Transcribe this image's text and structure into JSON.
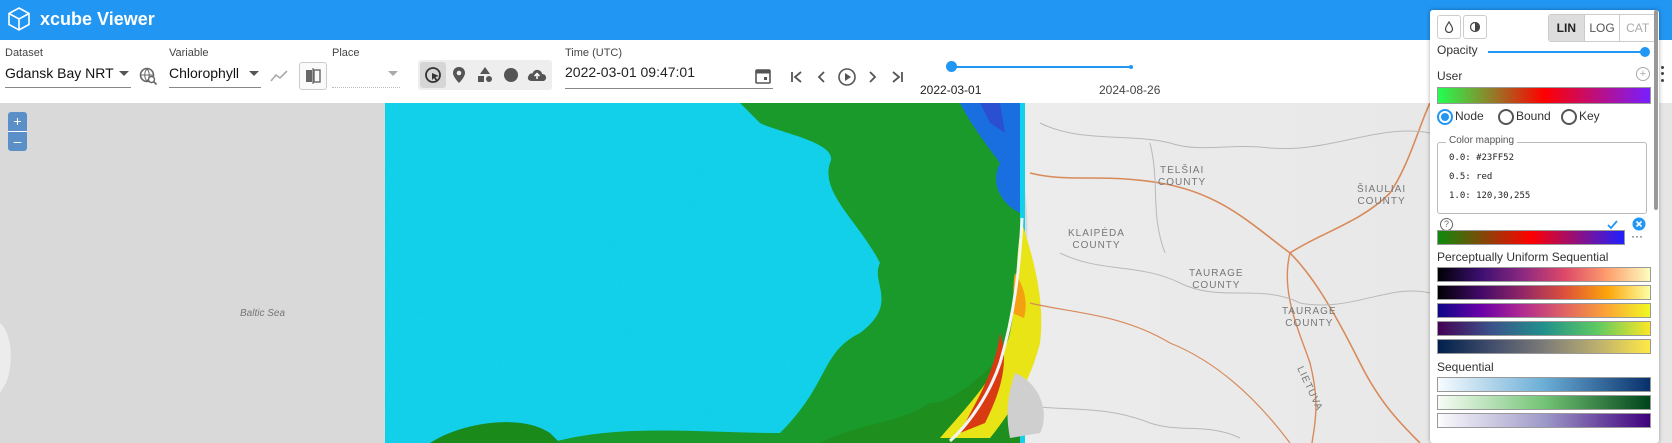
{
  "app": {
    "title": "xcube Viewer"
  },
  "toolbar": {
    "dataset": {
      "label": "Dataset",
      "value": "Gdansk Bay NRT"
    },
    "variable": {
      "label": "Variable",
      "value": "Chlorophyll"
    },
    "place": {
      "label": "Place",
      "value": ""
    },
    "time": {
      "label": "Time (UTC)",
      "value": "2022-03-01 09:47:01"
    },
    "slider": {
      "start": "2022-03-01",
      "end": "2024-08-26",
      "position": 0
    }
  },
  "map": {
    "labels": {
      "baltic_sea": "Baltic Sea",
      "telsiai": "TELŠIAI\nCOUNTY",
      "siauliai": "ŠIAULIAI\nCOUNTY",
      "klaipeda": "KLAIPĖDA\nCOUNTY",
      "taurage1": "TAURAGE\nCOUNTY",
      "taurage2": "TAURAGE\nCOUNTY",
      "lietuva": "LIETUVA"
    },
    "zoom_in": "+",
    "zoom_out": "–"
  },
  "colorbar_panel": {
    "scale_modes": [
      "LIN",
      "LOG",
      "CAT"
    ],
    "selected_scale": "LIN",
    "opacity_label": "Opacity",
    "opacity_value": 1.0,
    "user_label": "User",
    "radio_options": [
      "Node",
      "Bound",
      "Key"
    ],
    "selected_radio": "Node",
    "mapping_legend": "Color mapping",
    "mapping_lines": [
      "0.0: #23FF52",
      "0.5: red",
      "1.0: 120,30,255"
    ],
    "more": "···",
    "section_uniform": "Perceptually Uniform Sequential",
    "section_sequential": "Sequential"
  },
  "colors": {
    "brand": "#2196f3",
    "user_gradient": [
      "#23FF52",
      "#ff0000",
      "#781EFF"
    ]
  }
}
